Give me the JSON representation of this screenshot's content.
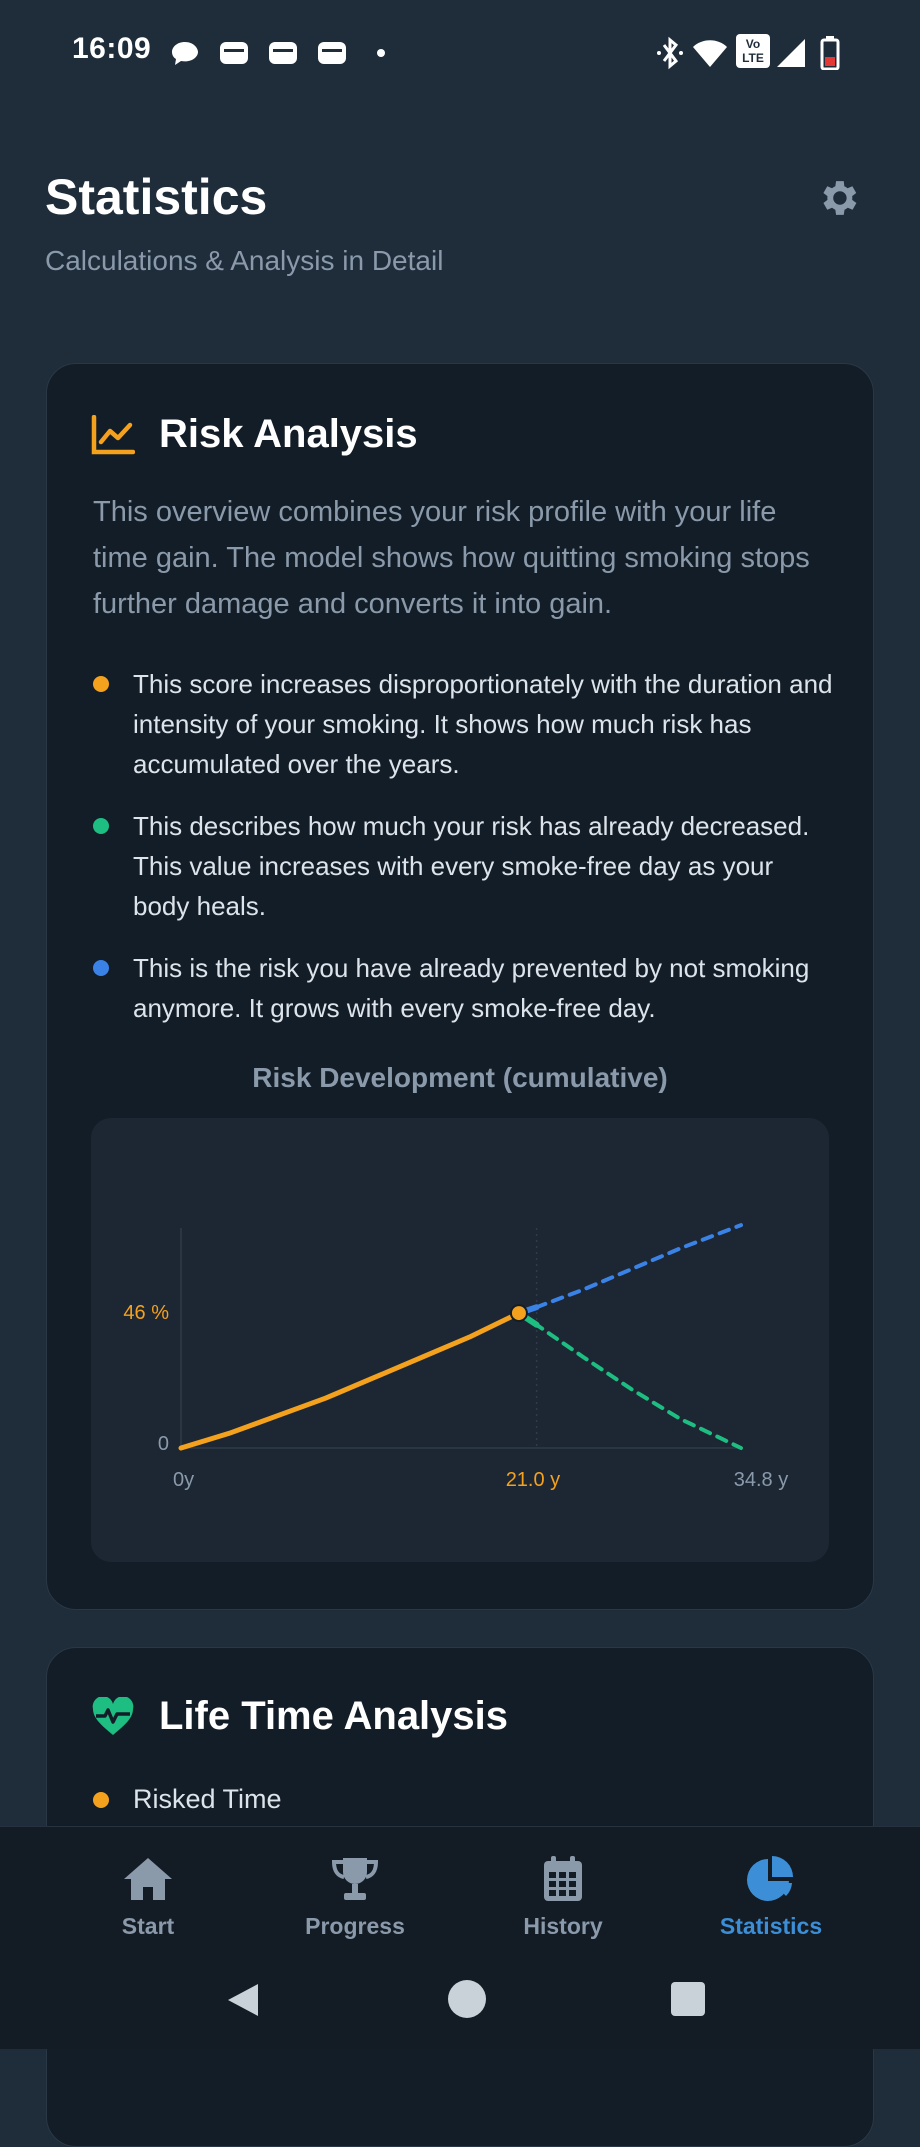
{
  "status_bar": {
    "time": "16:09",
    "icons": [
      "chat-bubble-icon",
      "wallet-icon",
      "wallet-icon",
      "wallet-icon",
      "dot-icon",
      "bluetooth-icon",
      "wifi-icon",
      "volte-icon",
      "signal-icon",
      "battery-icon"
    ],
    "volte_label": "Vo LTE"
  },
  "header": {
    "title": "Statistics",
    "subtitle": "Calculations & Analysis in Detail"
  },
  "risk_card": {
    "title": "Risk Analysis",
    "description": "This overview combines your risk profile with your life time gain. The model shows how quitting smoking stops further damage and converts it into gain.",
    "bullets": [
      {
        "color": "#f4a11e",
        "text": "This score increases disproportionately with the duration and intensity of your smoking. It shows how much risk has accumulated over the years."
      },
      {
        "color": "#1ebd82",
        "text": "This describes how much your risk has already decreased. This value increases with every smoke-free day as your body heals."
      },
      {
        "color": "#3b82e6",
        "text": "This is the risk you have already prevented by not smoking anymore. It grows with every smoke-free day."
      }
    ],
    "chart_title": "Risk Development (cumulative)"
  },
  "chart_data": {
    "type": "line",
    "title": "Risk Development (cumulative)",
    "xlabel": "",
    "ylabel": "",
    "xlim": [
      0,
      34.8
    ],
    "ylim": [
      0,
      75
    ],
    "y_tick_labels": [
      "0",
      "46 %"
    ],
    "x_tick_labels": [
      "0y",
      "21.0  y",
      "34.8  y"
    ],
    "current_x": 21.0,
    "current_y": 46,
    "series": [
      {
        "color": "#f4a11e",
        "style": "solid",
        "x": [
          0,
          3,
          6,
          9,
          12,
          15,
          18,
          21
        ],
        "y": [
          0,
          5,
          11,
          17,
          24,
          31,
          38,
          46
        ]
      },
      {
        "color": "#3b82e6",
        "style": "dashed",
        "x": [
          21,
          22.1,
          25,
          28,
          31,
          34.8
        ],
        "y": [
          46,
          48,
          54,
          61,
          68,
          76
        ]
      },
      {
        "color": "#1ebd82",
        "style": "dashed",
        "x": [
          21,
          22.1,
          25,
          28,
          31,
          34.8
        ],
        "y": [
          46,
          42,
          31,
          20,
          10,
          0
        ]
      }
    ],
    "colors": {
      "accent": "#f4a11e",
      "gain": "#1ebd82",
      "prevented": "#3b82e6"
    }
  },
  "life_card": {
    "title": "Life Time Analysis",
    "item_label": "Risked Time",
    "item_color": "#f4a11e"
  },
  "bottom_nav": {
    "items": [
      {
        "label": "Start",
        "icon": "home-icon"
      },
      {
        "label": "Progress",
        "icon": "trophy-icon"
      },
      {
        "label": "History",
        "icon": "calendar-icon"
      },
      {
        "label": "Statistics",
        "icon": "pie-chart-icon"
      }
    ],
    "active_index": 3
  },
  "system_nav": [
    "back-icon",
    "home-circle-icon",
    "recents-icon"
  ]
}
